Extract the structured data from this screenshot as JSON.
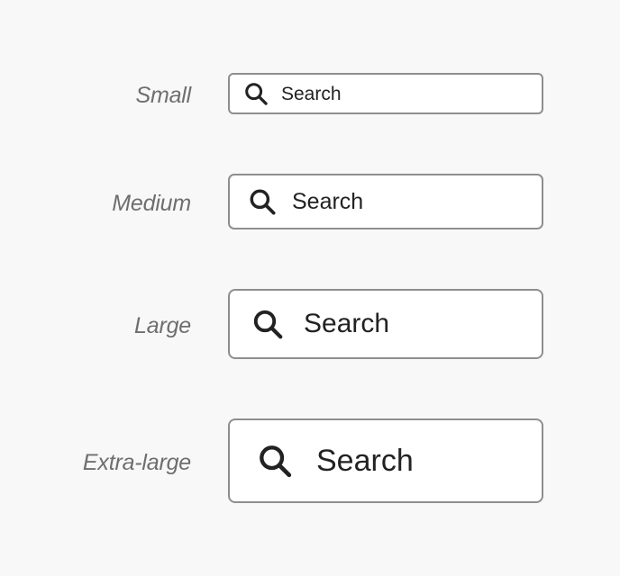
{
  "sizes": [
    {
      "label": "Small",
      "placeholder": "Search",
      "icon": "search-icon"
    },
    {
      "label": "Medium",
      "placeholder": "Search",
      "icon": "search-icon"
    },
    {
      "label": "Large",
      "placeholder": "Search",
      "icon": "search-icon"
    },
    {
      "label": "Extra-large",
      "placeholder": "Search",
      "icon": "search-icon"
    }
  ],
  "colors": {
    "background": "#f8f8f8",
    "field_background": "#ffffff",
    "field_border": "#8e8e8e",
    "label_text": "#6e6e6e",
    "field_text": "#222222"
  }
}
